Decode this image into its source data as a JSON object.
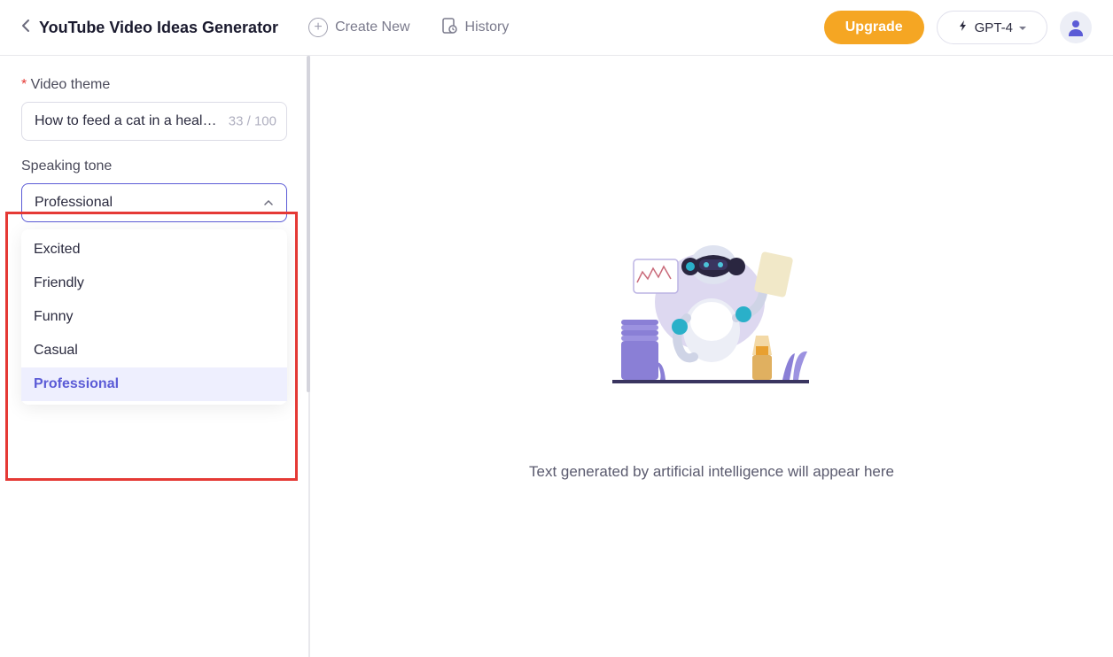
{
  "header": {
    "title": "YouTube Video Ideas Generator",
    "create_new": "Create New",
    "history": "History",
    "upgrade": "Upgrade",
    "model": "GPT-4"
  },
  "sidebar": {
    "video_theme": {
      "label": "Video theme",
      "value": "How to feed a cat in a healthy way",
      "counter": "33 / 100"
    },
    "speaking_tone": {
      "label": "Speaking tone",
      "selected": "Professional",
      "options": [
        "Excited",
        "Friendly",
        "Funny",
        "Casual",
        "Professional"
      ]
    }
  },
  "main": {
    "empty_text": "Text generated by artificial intelligence will appear here"
  }
}
